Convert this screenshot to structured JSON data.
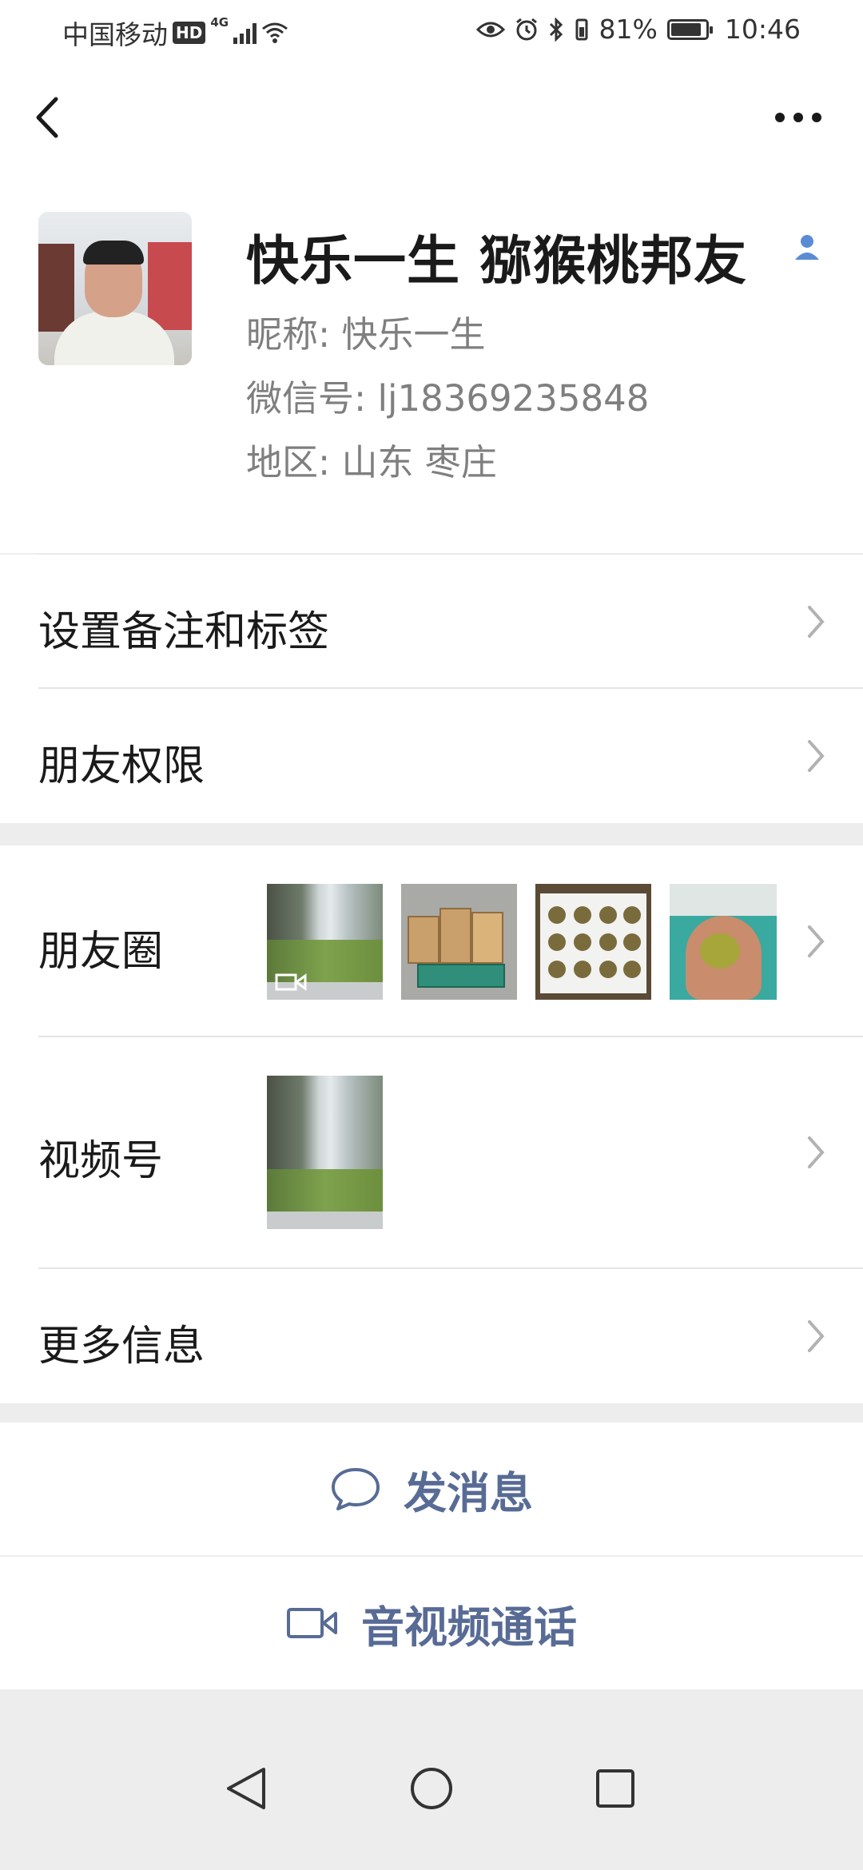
{
  "status_bar": {
    "carrier": "中国移动",
    "hd_badge": "HD",
    "network": "4G",
    "battery_percent": "81%",
    "battery_level": 0.81,
    "time": "10:46",
    "icons": [
      "eye-icon",
      "alarm-icon",
      "bluetooth-icon",
      "vibrate-icon",
      "battery-icon"
    ]
  },
  "nav": {
    "back_icon": "chevron-left-icon",
    "more_icon": "more-dots-icon"
  },
  "profile": {
    "name": "快乐一生 猕猴桃邦友",
    "gender_icon": "person-icon",
    "nickname": "昵称: 快乐一生",
    "wechat_id": "微信号: lj18369235848",
    "region": "地区: 山东  枣庄"
  },
  "rows": {
    "remark": "设置备注和标签",
    "permissions": "朋友权限",
    "moments": "朋友圈",
    "channels": "视频号",
    "more_info": "更多信息"
  },
  "actions": {
    "message": "发消息",
    "call": "音视频通话"
  },
  "colors": {
    "link_blue": "#576b95",
    "background": "#ededed",
    "text_primary": "#1a1a1a",
    "text_secondary": "#7f7f7f"
  }
}
